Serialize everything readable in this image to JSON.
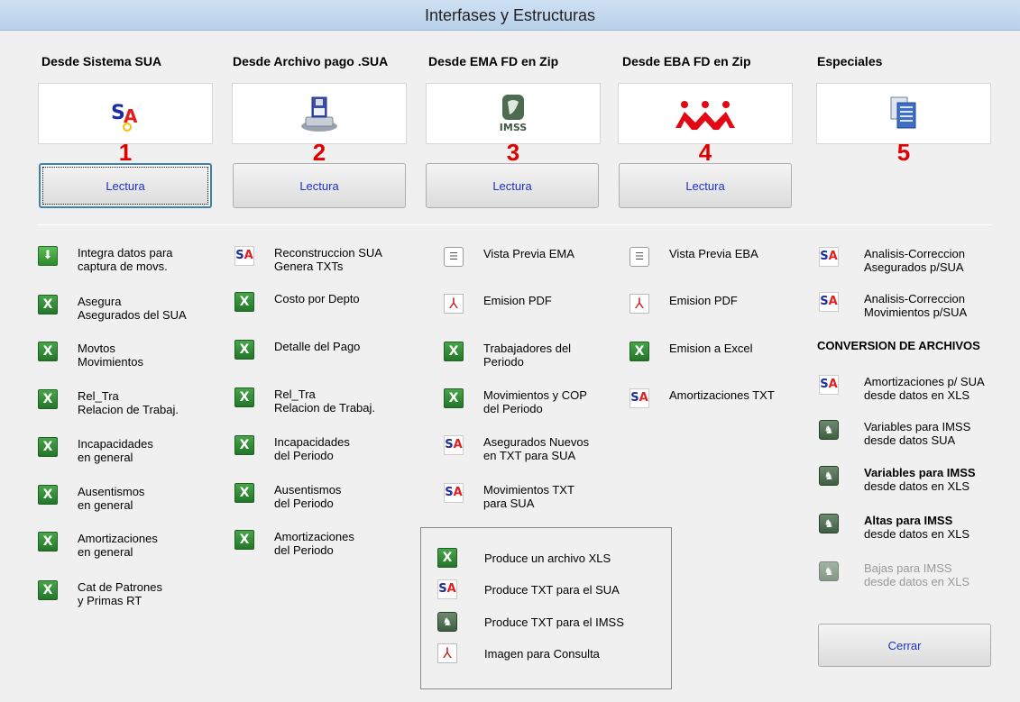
{
  "window": {
    "title": "Interfases y Estructuras"
  },
  "sources": [
    {
      "heading": "Desde Sistema SUA",
      "number": "1",
      "button": "Lectura",
      "icon": "sua-logo-icon"
    },
    {
      "heading": "Desde Archivo pago .SUA",
      "number": "2",
      "button": "Lectura",
      "icon": "disk-drive-icon"
    },
    {
      "heading": "Desde EMA FD en Zip",
      "number": "3",
      "button": "Lectura",
      "icon": "imss-logo-icon"
    },
    {
      "heading": "Desde EBA FD en Zip",
      "number": "4",
      "button": "Lectura",
      "icon": "infonavit-logo-icon"
    },
    {
      "heading": "Especiales",
      "number": "5",
      "button": "",
      "icon": "copy-documents-icon"
    }
  ],
  "columns": {
    "col1": [
      {
        "icon": "download-icon",
        "l1": "Integra datos para",
        "l2": "captura de movs."
      },
      {
        "icon": "excel-icon",
        "l1": "Asegura",
        "l2": "Asegurados del SUA"
      },
      {
        "icon": "excel-icon",
        "l1": "Movtos",
        "l2": "Movimientos"
      },
      {
        "icon": "excel-icon",
        "l1": "Rel_Tra",
        "l2": "Relacion de Trabaj."
      },
      {
        "icon": "excel-icon",
        "l1": "Incapacidades",
        "l2": "en general"
      },
      {
        "icon": "excel-icon",
        "l1": "Ausentismos",
        "l2": "en general"
      },
      {
        "icon": "excel-icon",
        "l1": "Amortizaciones",
        "l2": "en general"
      },
      {
        "icon": "excel-icon",
        "l1": "Cat de Patrones",
        "l2": "y Primas RT"
      }
    ],
    "col2": [
      {
        "icon": "sua-icon",
        "l1": "Reconstruccion SUA",
        "l2": "Genera TXTs"
      },
      {
        "icon": "excel-icon",
        "l1": "Costo por Depto",
        "l2": ""
      },
      {
        "icon": "excel-icon",
        "l1": "Detalle del Pago",
        "l2": ""
      },
      {
        "icon": "excel-icon",
        "l1": "Rel_Tra",
        "l2": "Relacion de Trabaj."
      },
      {
        "icon": "excel-icon",
        "l1": "Incapacidades",
        "l2": "del Periodo"
      },
      {
        "icon": "excel-icon",
        "l1": "Ausentismos",
        "l2": "del Periodo"
      },
      {
        "icon": "excel-icon",
        "l1": "Amortizaciones",
        "l2": "del Periodo"
      }
    ],
    "col3": [
      {
        "icon": "notepad-icon",
        "l1": "Vista Previa EMA",
        "l2": ""
      },
      {
        "icon": "pdf-icon",
        "l1": "Emision PDF",
        "l2": ""
      },
      {
        "icon": "excel-icon",
        "l1": "Trabajadores del",
        "l2": "Periodo"
      },
      {
        "icon": "excel-icon",
        "l1": "Movimientos y COP",
        "l2": "del Periodo"
      },
      {
        "icon": "sua-icon",
        "l1": "Asegurados Nuevos",
        "l2": "en TXT para SUA"
      },
      {
        "icon": "sua-icon",
        "l1": "Movimientos TXT",
        "l2": "para SUA"
      }
    ],
    "col4": [
      {
        "icon": "notepad-icon",
        "l1": "Vista Previa EBA",
        "l2": ""
      },
      {
        "icon": "pdf-icon",
        "l1": "Emision PDF",
        "l2": ""
      },
      {
        "icon": "excel-icon",
        "l1": "Emision a Excel",
        "l2": ""
      },
      {
        "icon": "sua-icon",
        "l1": "Amortizaciones TXT",
        "l2": ""
      }
    ],
    "col5_top": [
      {
        "icon": "sua-icon",
        "l1": "Analisis-Correccion",
        "l2": "Asegurados p/SUA"
      },
      {
        "icon": "sua-icon",
        "l1": "Analisis-Correccion",
        "l2": "Movimientos p/SUA"
      }
    ],
    "conversion_title": "CONVERSION DE ARCHIVOS",
    "col5_bottom": [
      {
        "icon": "sua-icon",
        "l1": "Amortizaciones p/ SUA",
        "l2": "desde datos en XLS"
      },
      {
        "icon": "imss-icon",
        "l1": "Variables para IMSS",
        "l2": "desde datos SUA"
      },
      {
        "icon": "imss-icon",
        "l1": "Variables para IMSS",
        "l2": "desde datos en XLS"
      },
      {
        "icon": "imss-icon",
        "l1": "Altas para IMSS",
        "l2": "desde datos en XLS"
      },
      {
        "icon": "imss-icon",
        "l1": "Bajas para IMSS",
        "l2": "desde datos en XLS"
      }
    ]
  },
  "legend": [
    {
      "icon": "excel-icon",
      "text": "Produce un archivo XLS"
    },
    {
      "icon": "sua-icon",
      "text": "Produce TXT para el SUA"
    },
    {
      "icon": "imss-icon",
      "text": "Produce TXT para el IMSS"
    },
    {
      "icon": "pdf-icon",
      "text": "Imagen para Consulta"
    }
  ],
  "close_button": "Cerrar",
  "colors": {
    "number_red": "#e00000",
    "button_text": "#1a33c4",
    "title_bar": "#c4d9ef",
    "excel_green": "#2f8a33"
  }
}
